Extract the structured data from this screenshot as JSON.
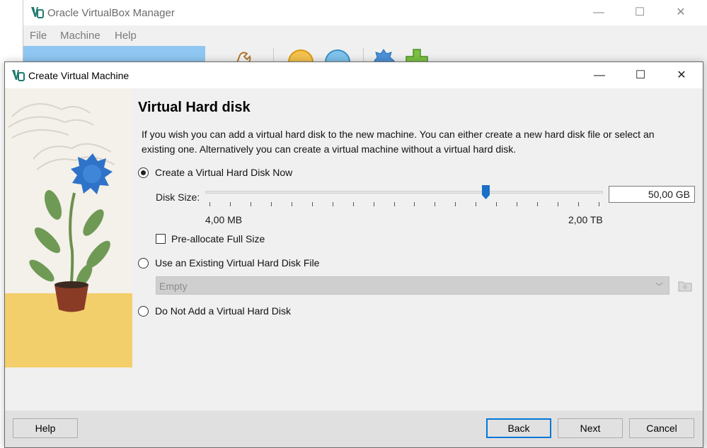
{
  "main_window": {
    "title": "Oracle VirtualBox Manager",
    "menu": [
      "File",
      "Machine",
      "Help"
    ]
  },
  "dialog": {
    "title": "Create Virtual Machine",
    "heading": "Virtual Hard disk",
    "description": "If you wish you can add a virtual hard disk to the new machine. You can either create a new hard disk file or select an existing one. Alternatively you can create a virtual machine without a virtual hard disk.",
    "options": {
      "create_now": {
        "label": "Create a Virtual Hard Disk Now",
        "selected": true
      },
      "use_existing": {
        "label": "Use an Existing Virtual Hard Disk File",
        "selected": false
      },
      "do_not_add": {
        "label": "Do Not Add a Virtual Hard Disk",
        "selected": false
      }
    },
    "disk_size": {
      "label": "Disk Size:",
      "value": "50,00 GB",
      "min_label": "4,00 MB",
      "max_label": "2,00 TB",
      "slider_fraction": 0.705
    },
    "preallocate": {
      "label": "Pre-allocate Full Size",
      "checked": false
    },
    "existing_select": {
      "value": "Empty"
    },
    "buttons": {
      "help": "Help",
      "back": "Back",
      "next": "Next",
      "cancel": "Cancel"
    }
  },
  "colors": {
    "accent": "#0078d7",
    "slider_handle": "#1a6fc6",
    "vm_list_selection": "#8fc7f2",
    "illustration_floor": "#f3cf6b",
    "flower": "#2f73c8"
  }
}
